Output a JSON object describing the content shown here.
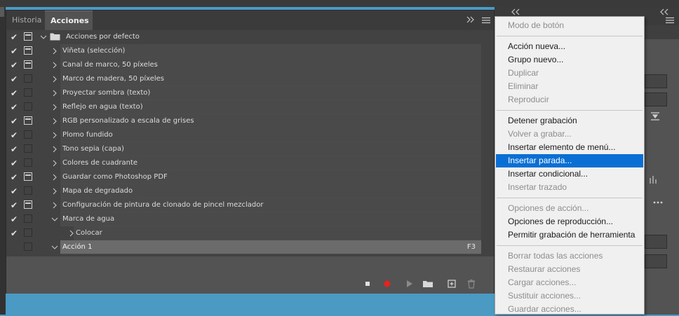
{
  "tabs": [
    {
      "label": "Historia",
      "active": false
    },
    {
      "label": "Acciones",
      "active": true
    }
  ],
  "panel_controls": {
    "collapse_icon": "double-chevron-right",
    "menu_icon": "hamburger"
  },
  "actions": [
    {
      "label": "Acciones por defecto",
      "checked": true,
      "dialog": true,
      "level": 0,
      "expanded": true,
      "folder": true
    },
    {
      "label": "Viñeta (selección)",
      "checked": true,
      "dialog": true,
      "level": 1,
      "expanded": false
    },
    {
      "label": "Canal de marco, 50 píxeles",
      "checked": true,
      "dialog": true,
      "level": 1,
      "expanded": false
    },
    {
      "label": "Marco de madera, 50 píxeles",
      "checked": true,
      "dialog": false,
      "level": 1,
      "expanded": false
    },
    {
      "label": "Proyectar sombra (texto)",
      "checked": true,
      "dialog": false,
      "level": 1,
      "expanded": false
    },
    {
      "label": "Reflejo en agua (texto)",
      "checked": true,
      "dialog": false,
      "level": 1,
      "expanded": false
    },
    {
      "label": "RGB personalizado a escala de grises",
      "checked": true,
      "dialog": true,
      "level": 1,
      "expanded": false
    },
    {
      "label": "Plomo fundido",
      "checked": true,
      "dialog": false,
      "level": 1,
      "expanded": false
    },
    {
      "label": "Tono sepia (capa)",
      "checked": true,
      "dialog": false,
      "level": 1,
      "expanded": false
    },
    {
      "label": "Colores de cuadrante",
      "checked": true,
      "dialog": false,
      "level": 1,
      "expanded": false
    },
    {
      "label": "Guardar como Photoshop PDF",
      "checked": true,
      "dialog": true,
      "level": 1,
      "expanded": false
    },
    {
      "label": "Mapa de degradado",
      "checked": true,
      "dialog": false,
      "level": 1,
      "expanded": false
    },
    {
      "label": "Configuración de pintura de clonado de pincel mezclador",
      "checked": true,
      "dialog": true,
      "level": 1,
      "expanded": false
    },
    {
      "label": "Marca de agua",
      "checked": true,
      "dialog": false,
      "level": 1,
      "expanded": true
    },
    {
      "label": "Colocar",
      "checked": true,
      "dialog": false,
      "level": 2,
      "expanded": false
    },
    {
      "label": "Acción 1",
      "checked": false,
      "dialog": false,
      "level": 1,
      "expanded": true,
      "selected": true,
      "fkey": "F3"
    }
  ],
  "bottom_toolbar": [
    {
      "name": "stop-button",
      "icon": "stop-icon"
    },
    {
      "name": "record-button",
      "icon": "record-icon",
      "color": "#e8221f"
    },
    {
      "name": "play-button",
      "icon": "play-icon"
    },
    {
      "name": "new-set-button",
      "icon": "folder-icon"
    },
    {
      "name": "new-action-button",
      "icon": "new-icon"
    },
    {
      "name": "delete-button",
      "icon": "trash-icon"
    }
  ],
  "menu": {
    "items": [
      {
        "label": "Modo de botón",
        "enabled": false
      },
      {
        "sep": true
      },
      {
        "label": "Acción nueva...",
        "enabled": true
      },
      {
        "label": "Grupo nuevo...",
        "enabled": true
      },
      {
        "label": "Duplicar",
        "enabled": false
      },
      {
        "label": "Eliminar",
        "enabled": false
      },
      {
        "label": "Reproducir",
        "enabled": false
      },
      {
        "sep": true
      },
      {
        "label": "Detener grabación",
        "enabled": true
      },
      {
        "label": "Volver a grabar...",
        "enabled": false
      },
      {
        "label": "Insertar elemento de menú...",
        "enabled": true
      },
      {
        "label": "Insertar parada...",
        "enabled": true,
        "highlighted": true
      },
      {
        "label": "Insertar condicional...",
        "enabled": true
      },
      {
        "label": "Insertar trazado",
        "enabled": false
      },
      {
        "sep": true
      },
      {
        "label": "Opciones de acción...",
        "enabled": false
      },
      {
        "label": "Opciones de reproducción...",
        "enabled": true
      },
      {
        "label": "Permitir grabación de herramienta",
        "enabled": true
      },
      {
        "sep": true
      },
      {
        "label": "Borrar todas las acciones",
        "enabled": false
      },
      {
        "label": "Restaurar acciones",
        "enabled": false
      },
      {
        "label": "Cargar acciones...",
        "enabled": false
      },
      {
        "label": "Sustituir acciones...",
        "enabled": false
      },
      {
        "label": "Guardar acciones...",
        "enabled": false
      }
    ]
  },
  "colors": {
    "highlight": "#0a6fd4",
    "record": "#e8221f",
    "panel": "#535353",
    "list": "#424242"
  }
}
